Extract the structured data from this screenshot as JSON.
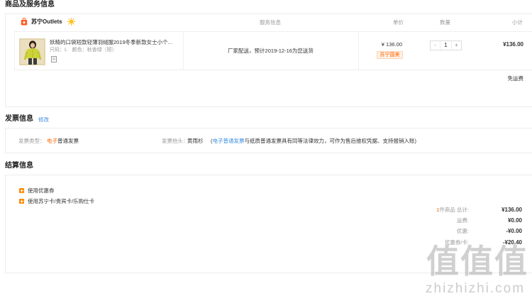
{
  "colors": {
    "accent": "#ff6600",
    "link": "#3d8fe3",
    "text": "#333333",
    "muted": "#999999",
    "border": "#ececec",
    "tag_bg": "#fff1e6",
    "coupon_icon": "#ff8a00"
  },
  "goods": {
    "title": "商品及服务信息",
    "store": {
      "name": "苏宁Outlets",
      "icon": "store-bag-icon",
      "badge_icon": "sun-badge-icon"
    },
    "columns": {
      "service": "服务信息",
      "price": "单价",
      "quantity": "数量",
      "subtotal": "小计"
    },
    "items": [
      {
        "title": "妖精的口袋短款轻薄羽绒服2019冬季新款女士小个...",
        "size_label": "尺码：",
        "size": "L",
        "color_label": "颜色：",
        "color": "秋香绿（短）",
        "extra_icon": "service-tag-icon",
        "service": "厂家配送，预计2019-12-16为您送货",
        "price": "¥ 136.00",
        "tag": "苏宁国美",
        "minus_label": "-",
        "quantity": "1",
        "plus_label": "+",
        "subtotal": "¥136.00"
      }
    ],
    "shipping_note": "免运费"
  },
  "invoice": {
    "title": "发票信息",
    "edit": "修改",
    "type_label": "发票类型：",
    "type_value_highlight": "电子",
    "type_value_rest": "普通发票",
    "header_label": "发票抬头：",
    "header_value": "黄雨杉",
    "note_open": "(",
    "note_highlight": "电子普通发票",
    "note_rest": "与纸质普通发票具有同等法律效力，可作为售后维权凭据、支持报销入账)"
  },
  "settlement": {
    "title": "结算信息",
    "options": [
      {
        "label": "使用优惠券",
        "icon": "plus-square-icon"
      },
      {
        "label": "使用苏宁卡/贵宾卡/乐购仕卡",
        "icon": "plus-square-icon"
      }
    ],
    "summary": [
      {
        "count": "1",
        "label": "件商品 总计:",
        "value": "¥136.00"
      },
      {
        "label": "运费:",
        "value": "¥0.00"
      },
      {
        "label": "优惠:",
        "value": "-¥0.00"
      },
      {
        "label": "优惠券/卡:",
        "value": "-¥20.40"
      }
    ]
  },
  "watermark": {
    "glyphs": [
      "值",
      "值",
      "值"
    ],
    "site": "zhizhizhi.com"
  }
}
